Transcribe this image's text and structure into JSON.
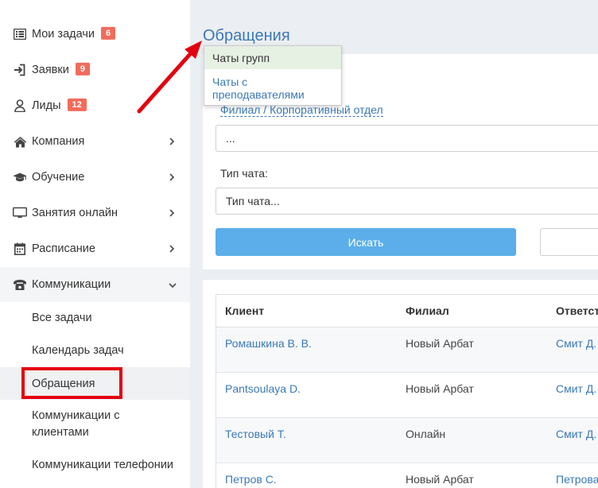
{
  "sidebar": {
    "items": [
      {
        "label": "Мои задачи",
        "badge": "6",
        "icon": "task-list-icon"
      },
      {
        "label": "Заявки",
        "badge": "9",
        "icon": "sign-in-icon"
      },
      {
        "label": "Лиды",
        "badge": "12",
        "icon": "user-icon"
      },
      {
        "label": "Компания",
        "icon": "home-icon"
      },
      {
        "label": "Обучение",
        "icon": "graduation-cap-icon"
      },
      {
        "label": "Занятия онлайн",
        "icon": "monitor-icon"
      },
      {
        "label": "Расписание",
        "icon": "calendar-icon"
      },
      {
        "label": "Коммуникации",
        "icon": "phone-icon"
      }
    ],
    "subitems": [
      {
        "label": "Все задачи"
      },
      {
        "label": "Календарь задач"
      },
      {
        "label": "Обращения"
      },
      {
        "label": "Коммуникации с клиентами"
      },
      {
        "label": "Коммуникации телефонии"
      }
    ]
  },
  "page": {
    "title": "Обращения"
  },
  "popup": {
    "options": [
      "Чаты групп",
      "Чаты с преподавателями"
    ]
  },
  "filters": {
    "branch_label": "Филиал / Корпоративный отдел",
    "branch_value": "...",
    "chat_type_label": "Тип чата:",
    "chat_type_value": "Тип чата...",
    "search_button": "Искать"
  },
  "table": {
    "headers": [
      "Клиент",
      "Филиал",
      "Ответст"
    ],
    "rows": [
      [
        "Ромашкина В. В.",
        "Новый Арбат",
        "Смит Д."
      ],
      [
        "Pantsoulaya D.",
        "Новый Арбат",
        "Смит Д."
      ],
      [
        "Тестовый Т.",
        "Онлайн",
        "Смит Д."
      ],
      [
        "Петров С.",
        "Новый Арбат",
        "Петрова"
      ]
    ]
  },
  "colors": {
    "accent": "#3a79b7",
    "badge": "#f26b5b",
    "button": "#5baee9",
    "annotation": "#e3000f"
  }
}
